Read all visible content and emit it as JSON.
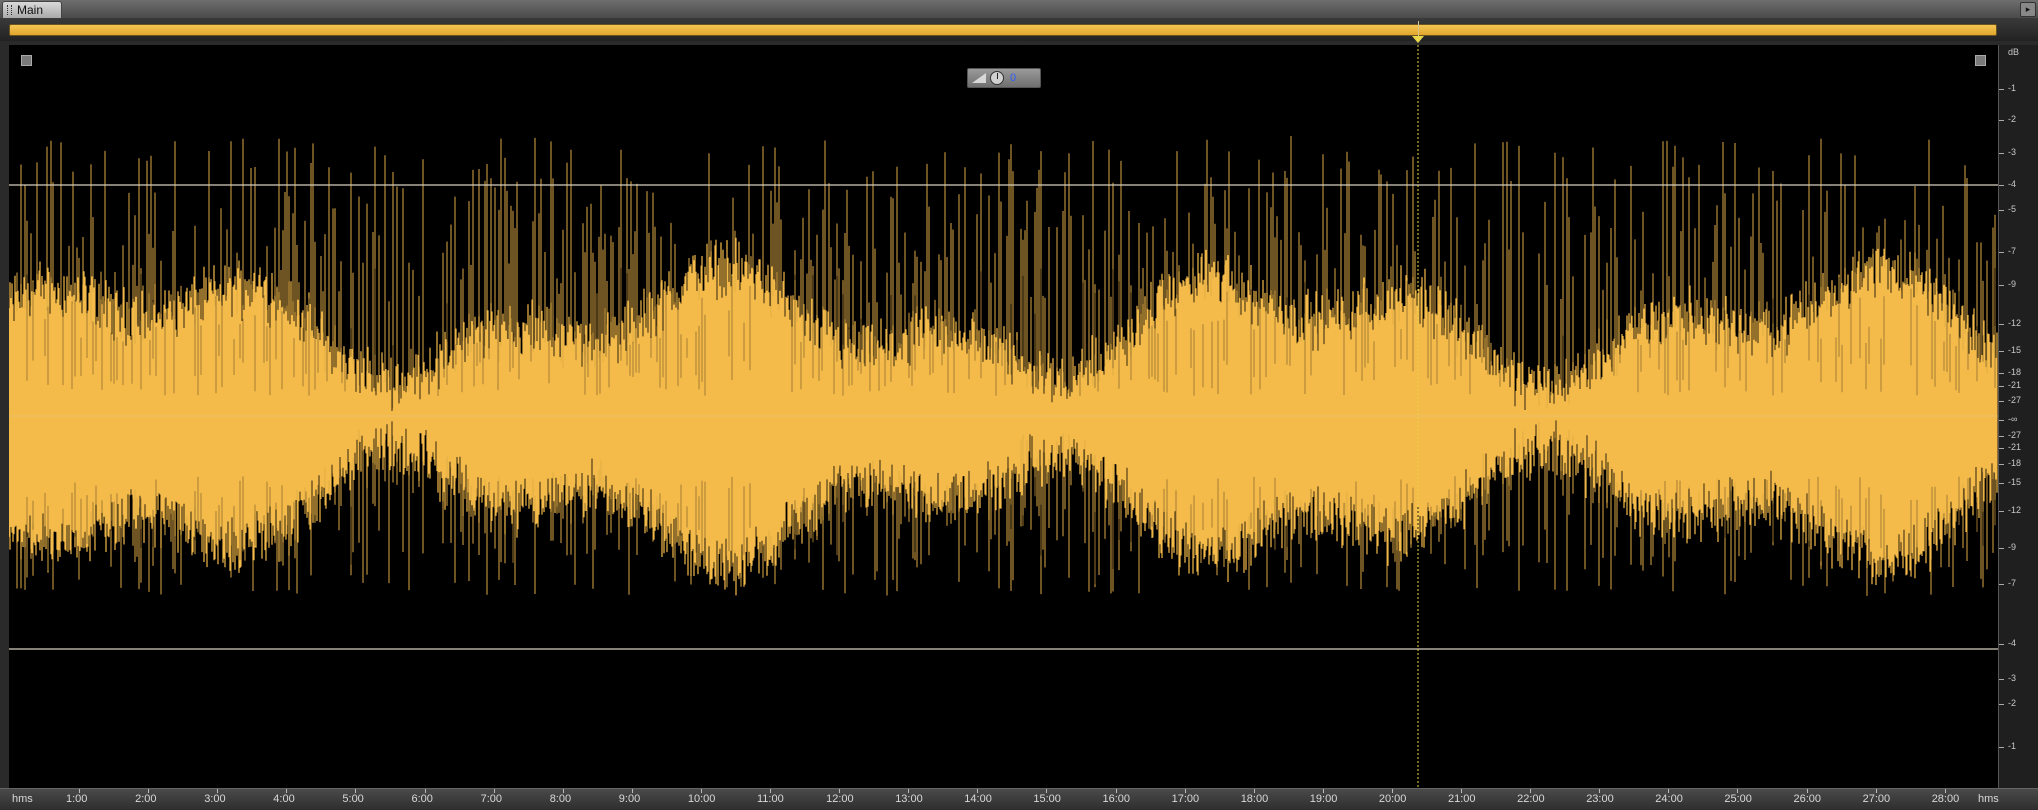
{
  "tabs": {
    "main_label": "Main"
  },
  "hud": {
    "gain_value": "0"
  },
  "db_ruler": {
    "unit": "dB",
    "labels": [
      "-1",
      "-2",
      "-3",
      "-4",
      "-5",
      "-7",
      "-9",
      "-12",
      "-15",
      "-18",
      "-21",
      "-27",
      "-∞",
      "-27",
      "-21",
      "-18",
      "-15",
      "-12",
      "-9",
      "-7",
      "-4",
      "-3",
      "-2",
      "-1"
    ]
  },
  "time_ruler": {
    "unit_left": "hms",
    "unit_right": "hms",
    "labels": [
      "1:00",
      "2:00",
      "3:00",
      "4:00",
      "5:00",
      "6:00",
      "7:00",
      "8:00",
      "9:00",
      "10:00",
      "11:00",
      "12:00",
      "13:00",
      "14:00",
      "15:00",
      "16:00",
      "17:00",
      "18:00",
      "19:00",
      "20:00",
      "21:00",
      "22:00",
      "23:00",
      "24:00",
      "25:00",
      "26:00",
      "27:00",
      "28:00"
    ]
  },
  "colors": {
    "waveform": "#f4bb4a",
    "background": "#000000",
    "clip_lines": "#d6d0bf",
    "playhead": "#e9d64a"
  },
  "icons": {
    "panel_menu": "triangle-right-icon",
    "zoom_tl": "zoom-corner-icon",
    "zoom_tr": "zoom-corner-icon",
    "volume_ramp": "ramp-icon",
    "volume_knob": "knob-icon"
  }
}
